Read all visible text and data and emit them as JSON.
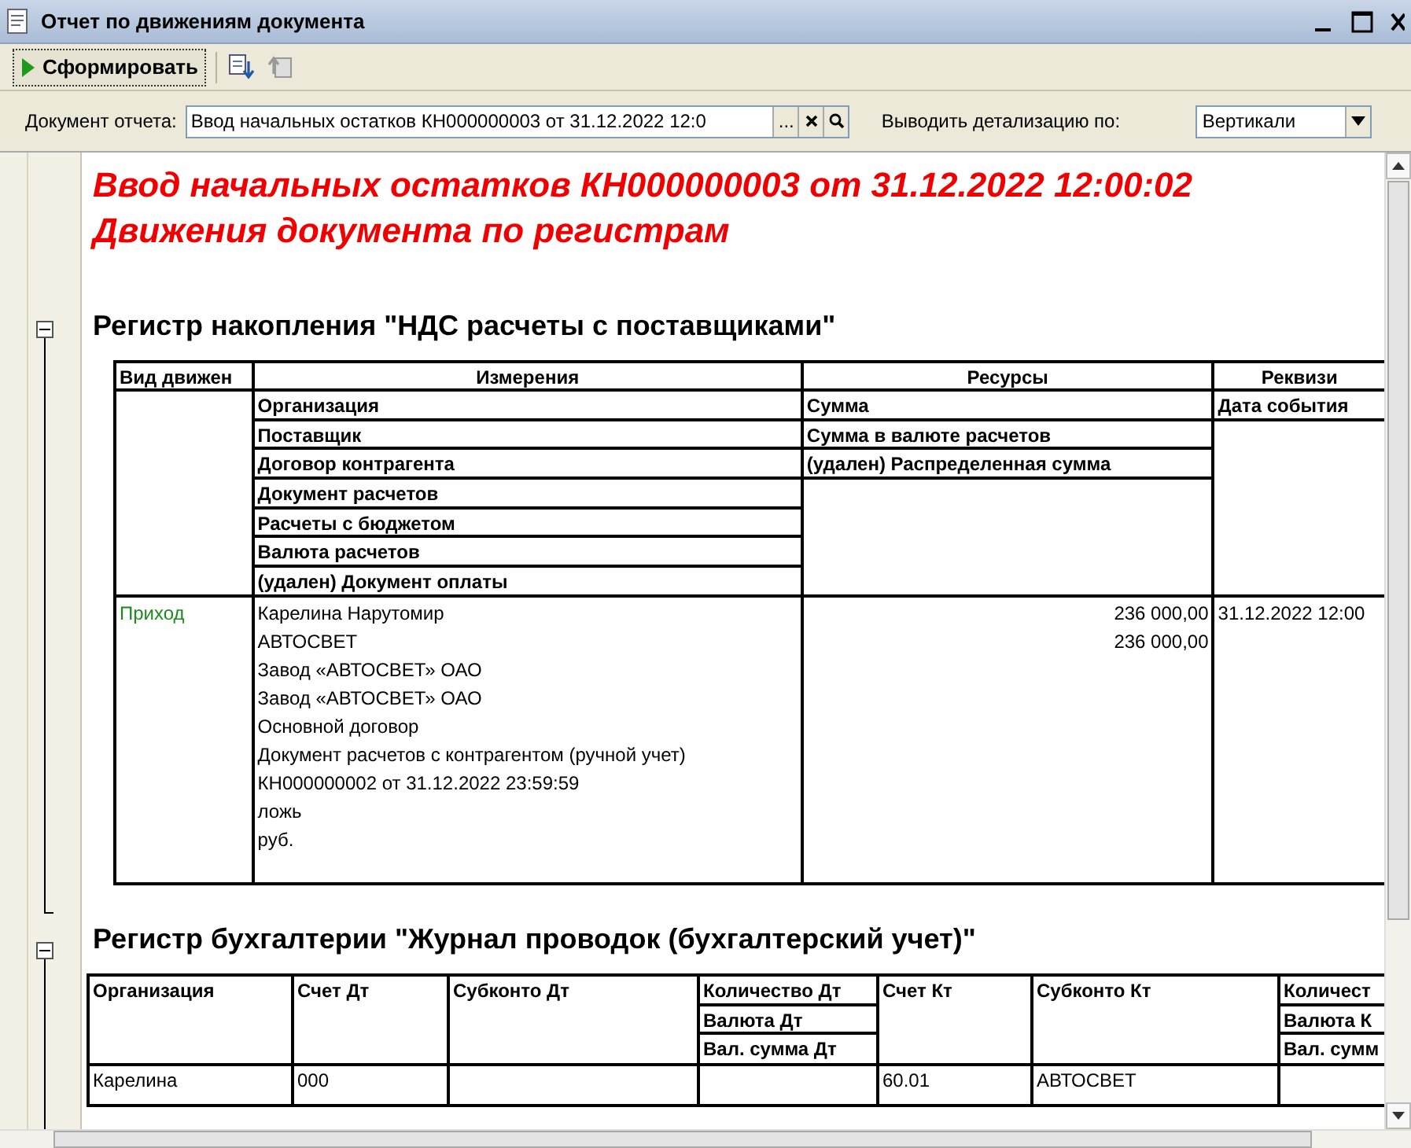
{
  "window": {
    "title": "Отчет по движениям документа"
  },
  "toolbar": {
    "generate_button": "Сформировать"
  },
  "params": {
    "document_label": "Документ отчета:",
    "document_value": "Ввод начальных остатков КН000000003 от 31.12.2022 12:0",
    "select_button": "...",
    "detail_label": "Выводить детализацию по:",
    "detail_value": "Вертикали"
  },
  "report": {
    "title_lines": [
      "Ввод начальных остатков КН000000003 от 31.12.2022 12:00:02",
      "Движения документа по регистрам"
    ],
    "sections": [
      {
        "kind": "accumulation",
        "title": "Регистр накопления \"НДС расчеты с поставщиками\"",
        "expanded": true,
        "columns": [
          {
            "kind": "movement",
            "header": "Вид движен",
            "values": [
              "Приход"
            ]
          },
          {
            "kind": "dimensions",
            "header": "Измерения",
            "fields": [
              "Организация",
              "Поставщик",
              "Договор контрагента",
              "Документ расчетов",
              "Расчеты с бюджетом",
              "Валюта расчетов",
              "(удален) Документ оплаты"
            ],
            "values": [
              "Карелина Нарутомир",
              "АВТОСВЕТ",
              "Завод «АВТОСВЕТ» ОАО",
              "Завод «АВТОСВЕТ» ОАО",
              "Основной договор",
              "Документ расчетов с контрагентом (ручной учет)",
              "КН000000002 от 31.12.2022 23:59:59",
              "ложь",
              "руб."
            ]
          },
          {
            "kind": "resources",
            "header": "Ресурсы",
            "fields": [
              "Сумма",
              "Сумма в валюте расчетов",
              "(удален) Распределенная сумма"
            ],
            "values": [
              "236 000,00",
              "236 000,00"
            ]
          },
          {
            "kind": "attributes",
            "header": "Реквизи",
            "fields": [
              "Дата события"
            ],
            "values": [
              "31.12.2022 12:00"
            ]
          }
        ]
      },
      {
        "kind": "accounting",
        "title": "Регистр бухгалтерии \"Журнал проводок (бухгалтерский учет)\"",
        "expanded": true,
        "columns": [
          {
            "headers": [
              "Организация"
            ],
            "values": [
              "Карелина"
            ]
          },
          {
            "headers": [
              "Счет Дт"
            ],
            "values": [
              "000"
            ]
          },
          {
            "headers": [
              "Субконто Дт"
            ]
          },
          {
            "headers": [
              "Количество Дт",
              "Валюта Дт",
              "Вал. сумма Дт"
            ]
          },
          {
            "headers": [
              "Счет Кт"
            ],
            "values": [
              "60.01"
            ]
          },
          {
            "headers": [
              "Субконто Кт"
            ],
            "values": [
              "АВТОСВЕТ"
            ]
          },
          {
            "headers": [
              "Количест",
              "Валюта К",
              "Вал. сумм"
            ]
          }
        ]
      }
    ]
  }
}
